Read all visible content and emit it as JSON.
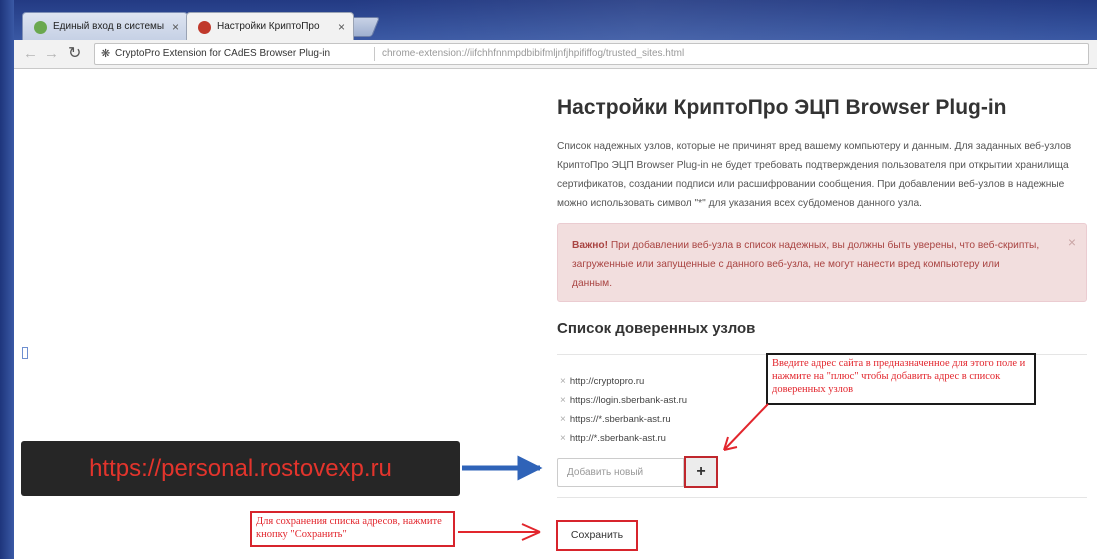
{
  "browser": {
    "tabs": [
      {
        "title": "Единый вход в системы",
        "active": false,
        "favicon_color": "#6aa84f"
      },
      {
        "title": "Настройки КриптоПро",
        "active": true,
        "favicon_color": "#c0392b"
      }
    ],
    "tab_close_glyph": "×",
    "extension_name": "CryptoPro Extension for CAdES Browser Plug-in",
    "url": "chrome-extension://iifchhfnnmpdbibifmljnfjhpififfog/trusted_sites.html",
    "icons": [
      "back-arrow-icon",
      "forward-arrow-icon",
      "reload-icon",
      "puzzle-piece-icon"
    ]
  },
  "page": {
    "title": "Настройки КриптоПро ЭЦП Browser Plug-in",
    "description": "Список надежных узлов, которые не причинят вред вашему компьютеру и данным. Для заданных веб-узлов КриптоПро ЭЦП Browser Plug-in не будет требовать подтверждения пользователя при открытии хранилища сертификатов, создании подписи или расшифровании сообщения. При добавлении веб-узлов в надежные можно использовать символ \"*\" для указания всех субдоменов данного узла.",
    "alert": {
      "strong": "Важно!",
      "text": " При добавлении веб-узла в список надежных, вы должны быть уверены, что веб-скрипты, загруженные или запущенные с данного веб-узла, не могут нанести вред компьютеру или данным.",
      "close": "×"
    },
    "trusted_title": "Список доверенных узлов",
    "trusted_sites": [
      "http://cryptopro.ru",
      "https://login.sberbank-ast.ru",
      "https://*.sberbank-ast.ru",
      "http://*.sberbank-ast.ru"
    ],
    "remove_glyph": "×",
    "add_placeholder": "Добавить новый",
    "add_button": "+",
    "save_button": "Сохранить"
  },
  "annotations": {
    "url_banner": "https://personal.rostovexp.ru",
    "note_add": "Введите адрес сайта в предназначенное для этого поле и нажмите на \"плюс\" чтобы добавить адрес в список доверенных узлов",
    "note_save": "Для сохранения списка адресов, нажмите кнопку \"Сохранить\"",
    "colors": {
      "annotation_red": "#e2262d",
      "arrow_blue": "#2f63b8",
      "alert_bg": "#f2dede",
      "alert_text": "#a94442"
    }
  }
}
